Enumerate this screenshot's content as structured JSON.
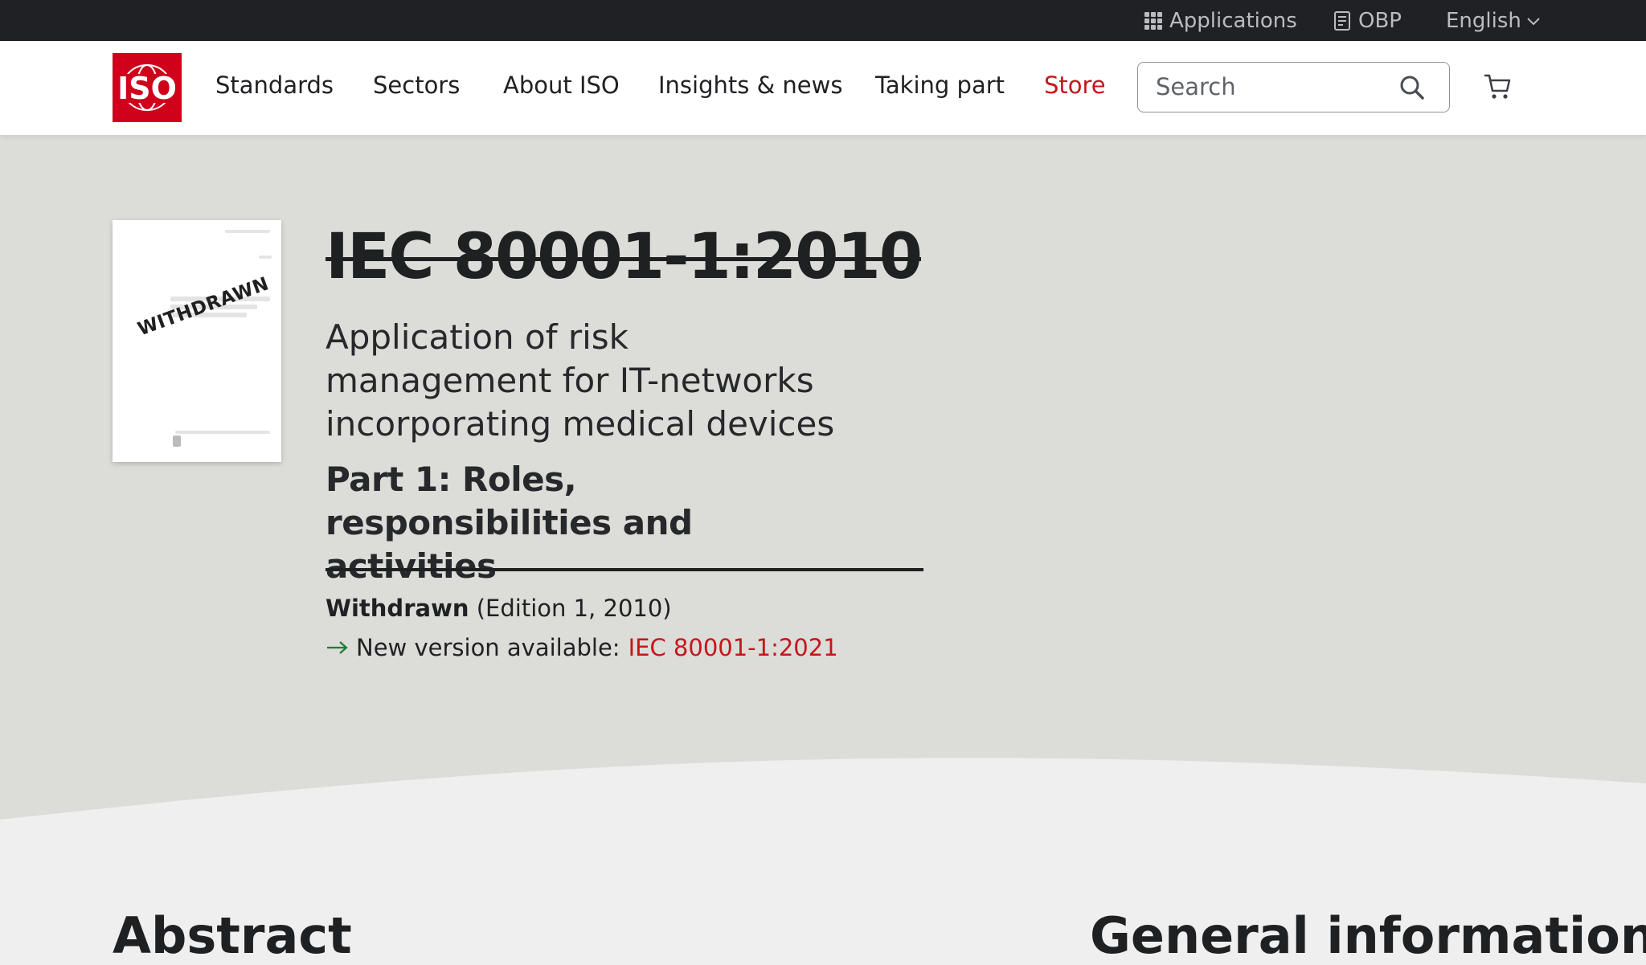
{
  "topbar": {
    "applications_label": "Applications",
    "obp_label": "OBP",
    "language_label": "English"
  },
  "nav": {
    "logo_text": "ISO",
    "items": [
      "Standards",
      "Sectors",
      "About ISO",
      "Insights & news",
      "Taking part",
      "Store"
    ],
    "search_placeholder": "Search"
  },
  "standard": {
    "cover_stamp": "WITHDRAWN",
    "reference": "IEC 80001-1:2010",
    "title": "Application of risk management for IT-networks incorporating medical devices",
    "part_title": "Part 1: Roles, responsibilities and activities",
    "status_label": "Withdrawn",
    "edition": "(Edition 1, 2010)",
    "new_version_prefix": "New version available:",
    "new_version_link": "IEC 80001-1:2021"
  },
  "sections": {
    "abstract_heading": "Abstract",
    "general_info_heading": "General information"
  },
  "colors": {
    "brand_red": "#d0021b",
    "link_red": "#c4161c",
    "hero_bg": "#dcdcd8",
    "arrow_green": "#1a7f37"
  }
}
